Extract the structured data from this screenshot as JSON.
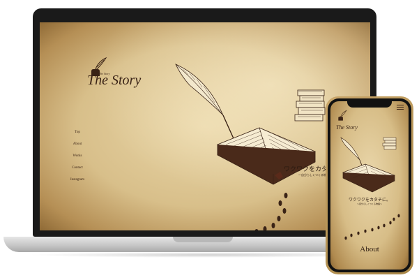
{
  "laptop": {
    "logo_text": "The Story",
    "logo_small": "The Story",
    "nav": [
      {
        "label": "Top"
      },
      {
        "label": "About"
      },
      {
        "label": "Works"
      },
      {
        "label": "Contact"
      },
      {
        "label": "Instagram"
      }
    ],
    "tagline": "ワクワクをカタチに。",
    "subtagline": "〜自分らしくつくる物語〜"
  },
  "phone": {
    "logo_text": "The Story",
    "tagline": "ワクワクをカタチに。",
    "subtagline": "〜自分らしくつくる物語〜",
    "section_title": "About"
  },
  "colors": {
    "ink": "#3a2316",
    "parchment": "#e9d6a8",
    "device_frame": "#1a1a1a",
    "phone_gold": "#c9a66a"
  },
  "icons": [
    "quill-pen-icon",
    "inkwell-icon",
    "book-stack-icon",
    "open-book-icon",
    "footprints-icon",
    "hamburger-menu-icon"
  ]
}
